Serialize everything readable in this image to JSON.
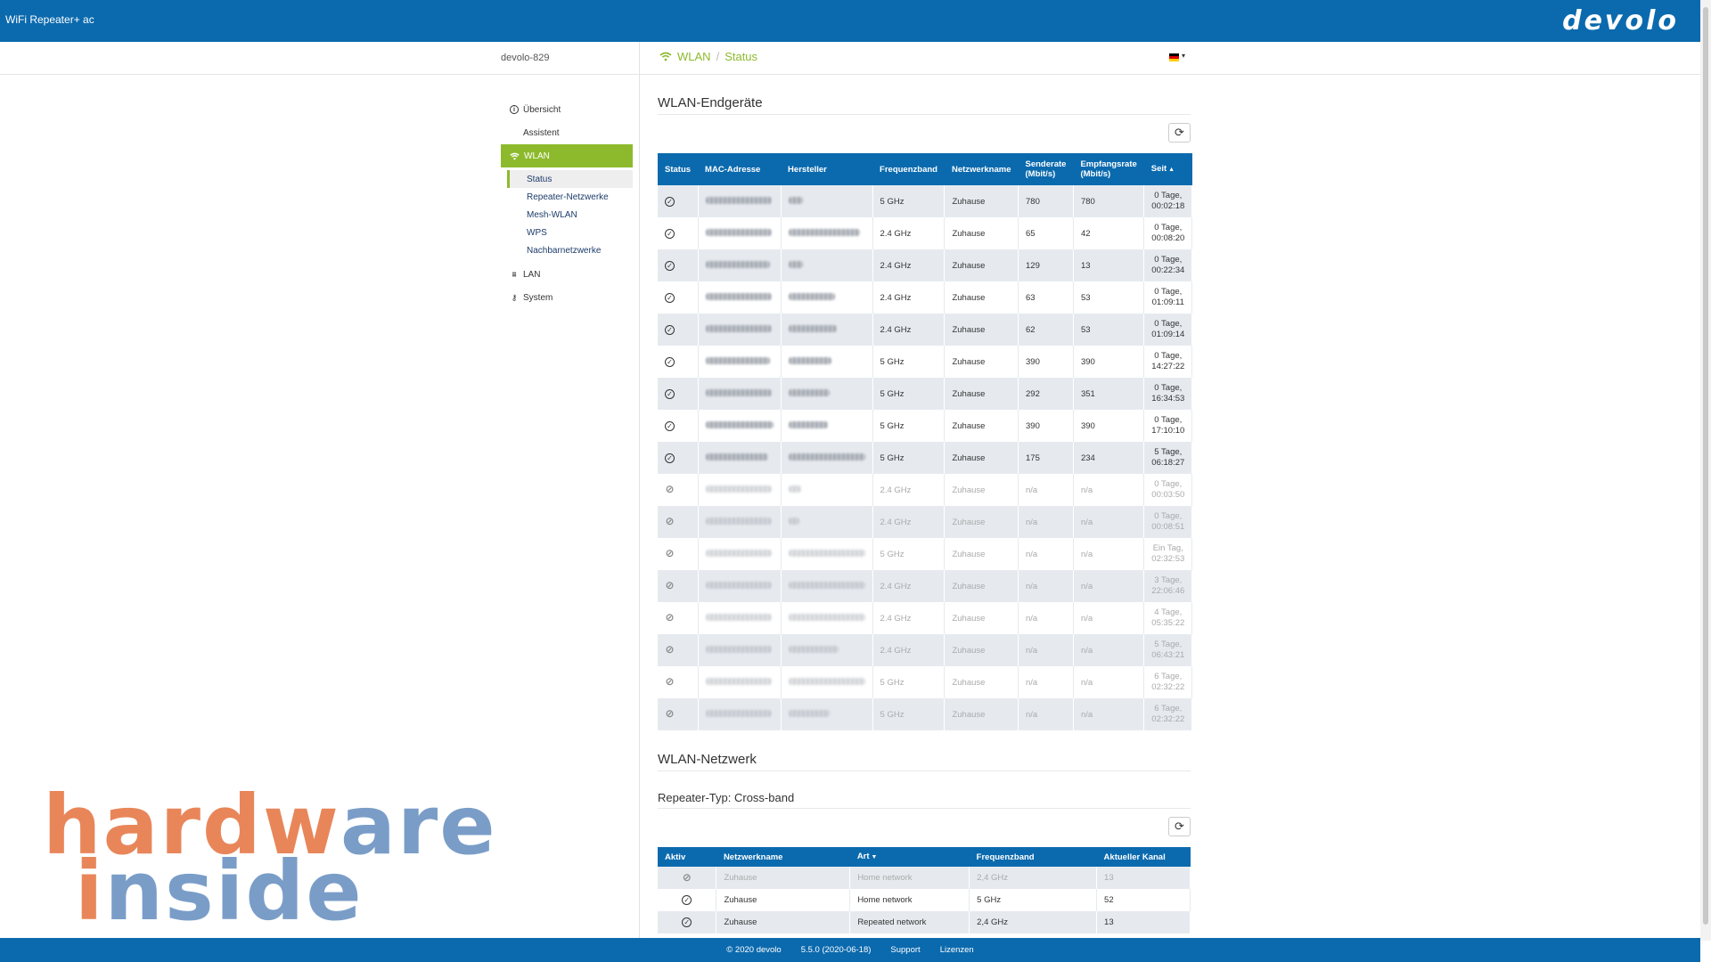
{
  "app": {
    "title": "WiFi Repeater+ ac",
    "brand": "devolo"
  },
  "header": {
    "device_name": "devolo-829",
    "breadcrumb": [
      "WLAN",
      "Status"
    ],
    "sep": "/"
  },
  "nav": {
    "items": [
      {
        "label": "Übersicht",
        "icon": "info-icon"
      },
      {
        "label": "Assistent"
      },
      {
        "label": "WLAN",
        "icon": "wifi-icon",
        "active": true
      },
      {
        "label": "LAN",
        "icon": "network-icon"
      },
      {
        "label": "System",
        "icon": "wrench-icon"
      }
    ],
    "wlan_sub": [
      "Status",
      "Repeater-Netzwerke",
      "Mesh-WLAN",
      "WPS",
      "Nachbarnetzwerke"
    ]
  },
  "devices": {
    "title": "WLAN-Endgeräte",
    "columns": [
      "Status",
      "MAC-Adresse",
      "Hersteller",
      "Frequenzband",
      "Netzwerkname",
      "Senderate (Mbit/s)",
      "Empfangsrate (Mbit/s)",
      "Seit"
    ],
    "rows": [
      {
        "active": true,
        "band": "5 GHz",
        "net": "Zuhause",
        "tx": "780",
        "rx": "780",
        "since1": "0 Tage,",
        "since2": "00:02:18",
        "mw": 74,
        "hw": 16
      },
      {
        "active": true,
        "band": "2.4 GHz",
        "net": "Zuhause",
        "tx": "65",
        "rx": "42",
        "since1": "0 Tage,",
        "since2": "00:08:20",
        "mw": 74,
        "hw": 80
      },
      {
        "active": true,
        "band": "2.4 GHz",
        "net": "Zuhause",
        "tx": "129",
        "rx": "13",
        "since1": "0 Tage,",
        "since2": "00:22:34",
        "mw": 72,
        "hw": 16
      },
      {
        "active": true,
        "band": "2.4 GHz",
        "net": "Zuhause",
        "tx": "63",
        "rx": "53",
        "since1": "0 Tage,",
        "since2": "01:09:11",
        "mw": 74,
        "hw": 52
      },
      {
        "active": true,
        "band": "2.4 GHz",
        "net": "Zuhause",
        "tx": "62",
        "rx": "53",
        "since1": "0 Tage,",
        "since2": "01:09:14",
        "mw": 74,
        "hw": 54
      },
      {
        "active": true,
        "band": "5 GHz",
        "net": "Zuhause",
        "tx": "390",
        "rx": "390",
        "since1": "0 Tage,",
        "since2": "14:27:22",
        "mw": 72,
        "hw": 48
      },
      {
        "active": true,
        "band": "5 GHz",
        "net": "Zuhause",
        "tx": "292",
        "rx": "351",
        "since1": "0 Tage,",
        "since2": "16:34:53",
        "mw": 74,
        "hw": 46
      },
      {
        "active": true,
        "band": "5 GHz",
        "net": "Zuhause",
        "tx": "390",
        "rx": "390",
        "since1": "0 Tage,",
        "since2": "17:10:10",
        "mw": 76,
        "hw": 44
      },
      {
        "active": true,
        "band": "5 GHz",
        "net": "Zuhause",
        "tx": "175",
        "rx": "234",
        "since1": "5 Tage,",
        "since2": "06:18:27",
        "mw": 70,
        "hw": 86
      },
      {
        "active": false,
        "band": "2.4 GHz",
        "net": "Zuhause",
        "tx": "n/a",
        "rx": "n/a",
        "since1": "0 Tage,",
        "since2": "00:03:50",
        "mw": 74,
        "hw": 14
      },
      {
        "active": false,
        "band": "2.4 GHz",
        "net": "Zuhause",
        "tx": "n/a",
        "rx": "n/a",
        "since1": "0 Tage,",
        "since2": "00:08:51",
        "mw": 74,
        "hw": 12
      },
      {
        "active": false,
        "band": "5 GHz",
        "net": "Zuhause",
        "tx": "n/a",
        "rx": "n/a",
        "since1": "Ein Tag,",
        "since2": "02:32:53",
        "mw": 74,
        "hw": 86
      },
      {
        "active": false,
        "band": "2.4 GHz",
        "net": "Zuhause",
        "tx": "n/a",
        "rx": "n/a",
        "since1": "3 Tage,",
        "since2": "22:06:46",
        "mw": 74,
        "hw": 86
      },
      {
        "active": false,
        "band": "2.4 GHz",
        "net": "Zuhause",
        "tx": "n/a",
        "rx": "n/a",
        "since1": "4 Tage,",
        "since2": "05:35:22",
        "mw": 74,
        "hw": 86
      },
      {
        "active": false,
        "band": "2.4 GHz",
        "net": "Zuhause",
        "tx": "n/a",
        "rx": "n/a",
        "since1": "5 Tage,",
        "since2": "06:43:21",
        "mw": 74,
        "hw": 56
      },
      {
        "active": false,
        "band": "5 GHz",
        "net": "Zuhause",
        "tx": "n/a",
        "rx": "n/a",
        "since1": "6 Tage,",
        "since2": "02:32:22",
        "mw": 74,
        "hw": 86
      },
      {
        "active": false,
        "band": "5 GHz",
        "net": "Zuhause",
        "tx": "n/a",
        "rx": "n/a",
        "since1": "6 Tage,",
        "since2": "02:32:22",
        "mw": 74,
        "hw": 46
      }
    ]
  },
  "network": {
    "title": "WLAN-Netzwerk",
    "repeater_type": "Repeater-Typ: Cross-band",
    "columns": [
      "Aktiv",
      "Netzwerkname",
      "Art",
      "Frequenzband",
      "Aktueller Kanal"
    ],
    "rows": [
      {
        "active": false,
        "name": "Zuhause",
        "type": "Home network",
        "band": "2,4 GHz",
        "channel": "13"
      },
      {
        "active": true,
        "name": "Zuhause",
        "type": "Home network",
        "band": "5 GHz",
        "channel": "52"
      },
      {
        "active": true,
        "name": "Zuhause",
        "type": "Repeated network",
        "band": "2,4 GHz",
        "channel": "13"
      }
    ]
  },
  "footer": {
    "copyright": "© 2020  devolo",
    "version": "5.5.0 (2020-06-18)",
    "support": "Support",
    "licenses": "Lizenzen"
  },
  "watermark": {
    "line1_a": "hard",
    "line1_b": "w",
    "line1_c": "are",
    "line2_a": "i",
    "line2_b": "nside"
  },
  "colors": {
    "primary": "#0b6aae",
    "accent": "#8dba2d"
  }
}
